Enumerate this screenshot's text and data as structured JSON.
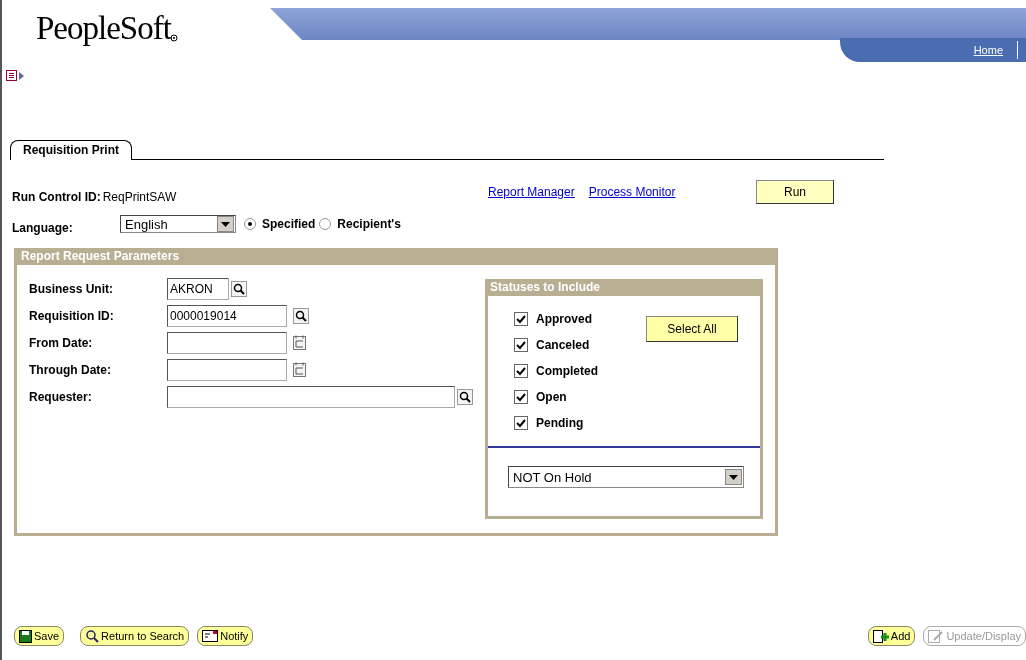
{
  "header": {
    "logo": "PeopleSoft",
    "links": [
      "Home"
    ]
  },
  "tab": {
    "label": "Requisition Print",
    "selected": true
  },
  "run_control": {
    "label": "Run Control ID:",
    "value": "ReqPrintSAW"
  },
  "links": [
    "Report Manager",
    "Process Monitor"
  ],
  "run_button": "Run",
  "language": {
    "label": "Language:",
    "value": "English",
    "options": [
      {
        "label": "Specified",
        "selected": true
      },
      {
        "label": "Recipient's",
        "selected": false
      }
    ]
  },
  "parameters": {
    "title": "Report Request Parameters",
    "fields": [
      {
        "label": "Business Unit:",
        "value": "AKRON",
        "kind": "lookup"
      },
      {
        "label": "Requisition ID:",
        "value": "0000019014",
        "kind": "lookup"
      },
      {
        "label": "From Date:",
        "kind": "date"
      },
      {
        "label": "Through Date:",
        "kind": "date"
      },
      {
        "label": "Requester:",
        "kind": "lookup"
      }
    ]
  },
  "statuses": {
    "title": "Statuses to Include",
    "items": [
      {
        "label": "Approved",
        "checked": true
      },
      {
        "label": "Canceled",
        "checked": true
      },
      {
        "label": "Completed",
        "checked": true
      },
      {
        "label": "Open",
        "checked": true
      },
      {
        "label": "Pending",
        "checked": true
      }
    ],
    "select_all": "Select All",
    "hold_filter": "NOT On Hold"
  },
  "footer": {
    "left": [
      {
        "label": "Save",
        "kind": "save",
        "disabled": false
      },
      {
        "label": "Return to Search",
        "kind": "search",
        "disabled": false
      },
      {
        "label": "Notify",
        "kind": "notify",
        "disabled": false
      }
    ],
    "right": [
      {
        "label": "Add",
        "kind": "add",
        "disabled": false
      },
      {
        "label": "Update/Display",
        "kind": "update",
        "disabled": true
      }
    ]
  }
}
